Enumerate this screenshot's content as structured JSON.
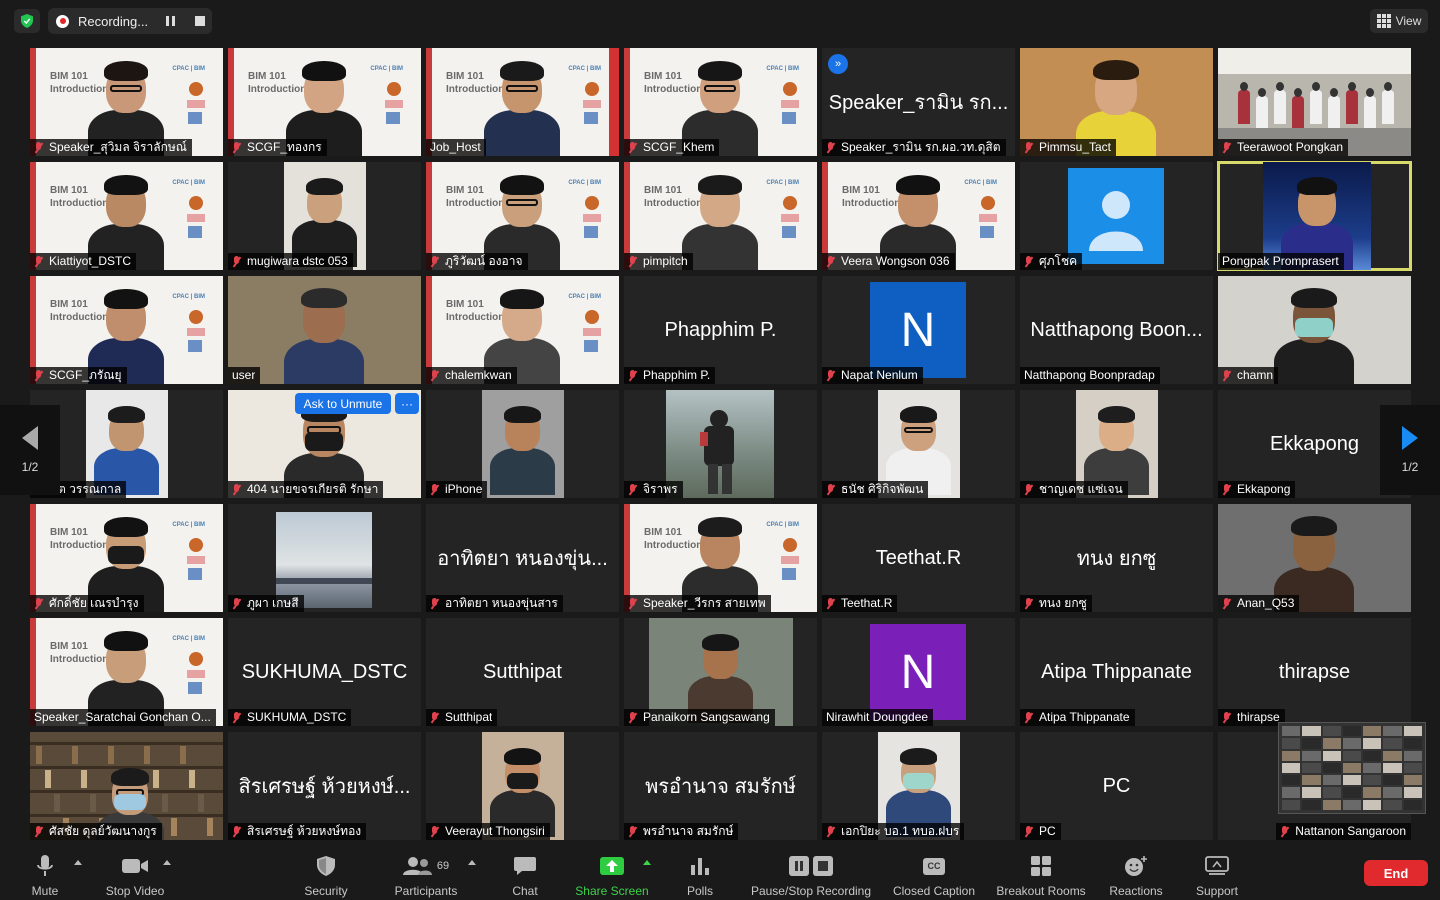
{
  "topbar": {
    "recording_label": "Recording...",
    "view_label": "View"
  },
  "tiles": [
    {
      "label": "Speaker_สุวิมล จิราลักษณ์",
      "muted": true,
      "kind": "slide",
      "skin": "#c89878",
      "hairc": "#1d1512",
      "shirt": "#222"
    },
    {
      "label": "SCGF_ทองกร",
      "muted": true,
      "kind": "slide",
      "skin": "#d2a483",
      "hairc": "#111",
      "shirt": "#1d1d1d"
    },
    {
      "label": "Job_Host",
      "muted": false,
      "kind": "slide2",
      "skin": "#c6946d",
      "hairc": "#1a1a1a",
      "shirt": "#233050"
    },
    {
      "label": "SCGF_Khem",
      "muted": true,
      "kind": "slide",
      "skin": "#d0a07e",
      "hairc": "#161616",
      "shirt": "#2c2c2c"
    },
    {
      "label": "Speaker_รามิน รก.ผอ.วท.ดุสิต",
      "muted": true,
      "kind": "name",
      "bigname": "Speaker_รามิน รก..."
    },
    {
      "label": "Pimmsu_Tact",
      "muted": true,
      "kind": "photo",
      "bg": "#c28e54",
      "skin": "#d7a782",
      "hairc": "#2a1d10",
      "shirt": "#e8d23a"
    },
    {
      "label": "Teerawoot Pongkan",
      "muted": true,
      "kind": "room",
      "bg": "#b9b6ad"
    },
    {
      "label": "Kiattiyot_DSTC",
      "muted": true,
      "kind": "slide",
      "skin": "#b98963",
      "hairc": "#121212",
      "shirt": "#222"
    },
    {
      "label": "mugiwara dstc 053",
      "muted": true,
      "kind": "narrow",
      "bg": "#e4e1db",
      "skin": "#caa07d",
      "hairc": "#1a1a1a",
      "shirt": "#1e1e1e"
    },
    {
      "label": "ภูริวัฒน์ องอาจ",
      "muted": true,
      "kind": "slide",
      "skin": "#c99f7c",
      "hairc": "#121212",
      "shirt": "#2a2a2a"
    },
    {
      "label": "pimpitch",
      "muted": true,
      "kind": "slide",
      "skin": "#d2a886",
      "hairc": "#1a1a1a",
      "shirt": "#333"
    },
    {
      "label": "Veera Wongson 036",
      "muted": true,
      "kind": "slide",
      "skin": "#c4906c",
      "hairc": "#111",
      "shirt": "#2a2a2a"
    },
    {
      "label": "ศุภโชค",
      "muted": true,
      "kind": "avatar-blank"
    },
    {
      "label": "Pongpak Promprasert",
      "muted": false,
      "kind": "space",
      "speaking": true,
      "skin": "#c79569",
      "hairc": "#111",
      "shirt": "#2a2e8a"
    },
    {
      "label": "SCGF_ภรัณยุ",
      "muted": true,
      "kind": "slide",
      "skin": "#c08e6c",
      "hairc": "#121212",
      "shirt": "#1f2a55"
    },
    {
      "label": "user",
      "muted": false,
      "kind": "photo",
      "bg": "#8a7d64",
      "skin": "#9c6d4f",
      "hairc": "#2b2b2b",
      "shirt": "#2c3b63"
    },
    {
      "label": "chalemkwan",
      "muted": true,
      "kind": "slide",
      "skin": "#d5aa8a",
      "hairc": "#161616",
      "shirt": "#444"
    },
    {
      "label": "Phapphim P.",
      "muted": true,
      "kind": "name",
      "bigname": "Phapphim P."
    },
    {
      "label": "Napat Nenlum",
      "muted": true,
      "kind": "avatar-letter",
      "letter": "N",
      "color": "#0f5fc2"
    },
    {
      "label": "Natthapong Boonpradap",
      "muted": false,
      "kind": "name",
      "bigname": "Natthapong Boon..."
    },
    {
      "label": "chamn",
      "muted": true,
      "kind": "mask",
      "bg": "#d4d2cc",
      "skin": "#7a5539",
      "hairc": "#1a1a1a",
      "shirt": "#1e1e1e"
    },
    {
      "label": "พนิมิต วรรณกาล",
      "muted": false,
      "kind": "narrow",
      "bg": "#e8e8e8",
      "skin": "#c29571",
      "hairc": "#1c1c1c",
      "shirt": "#2a56a8"
    },
    {
      "label": "404 นายขจรเกียรติ รักษา",
      "muted": true,
      "kind": "mask",
      "bg": "#ece8e0",
      "skin": "#b88660",
      "hairc": "#1a1a1a",
      "shirt": "#2a2a2a"
    },
    {
      "label": "iPhone",
      "muted": true,
      "kind": "narrow",
      "bg": "#9f9f9f",
      "skin": "#b8825b",
      "hairc": "#171717",
      "shirt": "#2b3b48"
    },
    {
      "label": "จิราพร",
      "muted": true,
      "kind": "outdoor",
      "bg": "#9aa6a2"
    },
    {
      "label": "ธนัช ศิริกิจพัฒน",
      "muted": true,
      "kind": "narrow",
      "bg": "#e5e3df",
      "skin": "#cda07e",
      "hairc": "#191919",
      "shirt": "#f0f0f0"
    },
    {
      "label": "ชาญเดช แซ่เจน",
      "muted": true,
      "kind": "narrow",
      "bg": "#d5cfc6",
      "skin": "#dcae88",
      "hairc": "#1e1e1e",
      "shirt": "#3d3d3d"
    },
    {
      "label": "Ekkapong",
      "muted": true,
      "kind": "name",
      "bigname": "Ekkapong"
    },
    {
      "label": "ศักดิ์ชัย เณรบำรุง",
      "muted": true,
      "kind": "mask-slide",
      "skin": "#c99c78",
      "hairc": "#121212",
      "shirt": "#1e1e1e"
    },
    {
      "label": "ภูผา เกษสี",
      "muted": true,
      "kind": "sky"
    },
    {
      "label": "อาทิตยา หนองขุ่นสาร",
      "muted": true,
      "kind": "name",
      "bigname": "อาทิตยา หนองขุ่น..."
    },
    {
      "label": "Speaker_วีรกร สายเทพ",
      "muted": true,
      "kind": "slide",
      "skin": "#b88560",
      "hairc": "#1c1c1c",
      "shirt": "#2c2c2c"
    },
    {
      "label": "Teethat.R",
      "muted": true,
      "kind": "name",
      "bigname": "Teethat.R"
    },
    {
      "label": "ทนง ยกซู",
      "muted": true,
      "kind": "name",
      "bigname": "ทนง ยกซู"
    },
    {
      "label": "Anan_Q53",
      "muted": true,
      "kind": "photo",
      "bg": "#6f6f6f",
      "skin": "#8a6240",
      "hairc": "#1a1a1a",
      "shirt": "#3a2a22"
    },
    {
      "label": "Speaker_Saratchai Gonchan O...",
      "muted": false,
      "kind": "slide",
      "skin": "#c89d7a",
      "hairc": "#111",
      "shirt": "#222"
    },
    {
      "label": "SUKHUMA_DSTC",
      "muted": true,
      "kind": "name",
      "bigname": "SUKHUMA_DSTC"
    },
    {
      "label": "Sutthipat",
      "muted": true,
      "kind": "name",
      "bigname": "Sutthipat"
    },
    {
      "label": "Panaikorn Sangsawang",
      "muted": true,
      "kind": "photo-narrow",
      "bg": "#7b8478",
      "skin": "#a6734c",
      "hairc": "#161616",
      "shirt": "#4a3a30"
    },
    {
      "label": "Nirawhit Doungdee",
      "muted": false,
      "kind": "avatar-letter",
      "letter": "N",
      "color": "#7a1fb8"
    },
    {
      "label": "Atipa Thippanate",
      "muted": true,
      "kind": "name",
      "bigname": "Atipa Thippanate"
    },
    {
      "label": "thirapse",
      "muted": true,
      "kind": "name",
      "bigname": "thirapse"
    },
    {
      "label": "ศัสชัย ดุลย์วัฒนางกูร",
      "muted": true,
      "kind": "library",
      "skin": "#c49c7a",
      "hairc": "#1b1b1b",
      "shirt": "#3a3a3a"
    },
    {
      "label": "สิรเศรษฐ์ ห้วยหงษ์ทอง",
      "muted": true,
      "kind": "name",
      "bigname": "สิรเศรษฐ์ ห้วยหงษ์..."
    },
    {
      "label": "Veerayut Thongsiri",
      "muted": true,
      "kind": "mask-narrow",
      "bg": "#c5b199",
      "skin": "#c48f68",
      "hairc": "#131313",
      "shirt": "#2a2a2a"
    },
    {
      "label": "พรอำนาจ สมรักษ์",
      "muted": true,
      "kind": "name",
      "bigname": "พรอำนาจ สมรักษ์"
    },
    {
      "label": "เอกปิยะ บอ.1 ทบอ.ฝบร",
      "muted": true,
      "kind": "mask-narrow",
      "bg": "#e6e4e0",
      "skin": "#c9a07e",
      "hairc": "#1b1b1b",
      "shirt": "#2f4a7a"
    },
    {
      "label": "PC",
      "muted": true,
      "kind": "name",
      "bigname": "PC"
    },
    {
      "label": "Nattanon Sangaroon",
      "muted": true,
      "kind": "blank"
    }
  ],
  "slide_text": {
    "line1": "BIM 101",
    "line2": "Introduction",
    "corner": "CPAC | BIM"
  },
  "ask_unmute_label": "Ask to Unmute",
  "more_label": "···",
  "pages": {
    "left": "1/2",
    "right": "1/2"
  },
  "toolbar": {
    "mute": "Mute",
    "stop_video": "Stop Video",
    "security": "Security",
    "participants": "Participants",
    "participants_count": "69",
    "chat": "Chat",
    "share_screen": "Share Screen",
    "polls": "Polls",
    "pause_recording": "Pause/Stop Recording",
    "closed_caption": "Closed Caption",
    "cc_badge": "CC",
    "breakout_rooms": "Breakout Rooms",
    "reactions": "Reactions",
    "support": "Support",
    "end": "End"
  }
}
